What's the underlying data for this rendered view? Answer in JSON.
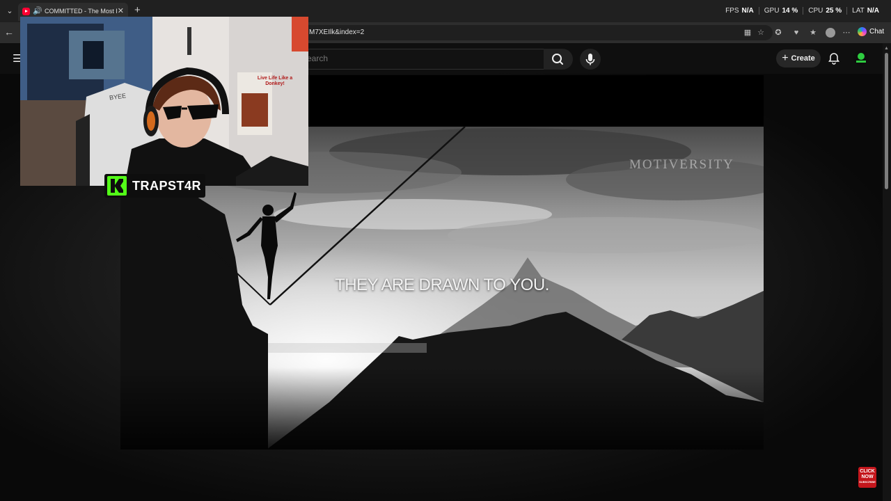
{
  "browser": {
    "tab_title": "COMMITTED - The Most Pow",
    "url": "M7XEIlk&index=2",
    "chat_label": "Chat"
  },
  "performance": {
    "fps_label": "FPS",
    "fps_value": "N/A",
    "gpu_label": "GPU",
    "gpu_value": "14 %",
    "cpu_label": "CPU",
    "cpu_value": "25 %",
    "lat_label": "LAT",
    "lat_value": "N/A"
  },
  "youtube": {
    "search_placeholder": "earch",
    "create_label": "Create"
  },
  "video": {
    "watermark": "MOTIVERSITY",
    "caption": "THEY ARE DRAWN TO YOU."
  },
  "webcam": {
    "streamer_name": "TRAPST4R",
    "sign_text": "Live Life Like a Donkey!",
    "chair_brand": "BYEE"
  },
  "subscribe_badge": {
    "line1": "CLICK",
    "line2": "NOW",
    "line3": "SUBSCRIBE"
  },
  "colors": {
    "kick_green": "#53fc18",
    "youtube_red": "#ff0033",
    "browser_bg": "#202020",
    "page_bg": "#0f0f0f"
  },
  "icons": [
    "chevron-down-icon",
    "youtube-favicon",
    "speaker-icon",
    "close-icon",
    "plus-icon",
    "back-arrow-icon",
    "menu-icon",
    "search-icon",
    "mic-icon",
    "bell-icon",
    "kick-logo"
  ]
}
